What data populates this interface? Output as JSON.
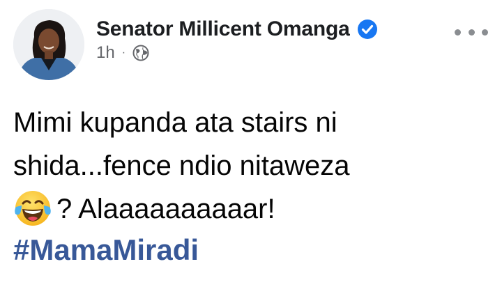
{
  "post": {
    "author": {
      "name": "Senator Millicent Omanga",
      "verified": true,
      "avatar_icon": "profile-photo"
    },
    "meta": {
      "time": "1h",
      "separator": "·",
      "audience_icon": "globe-icon"
    },
    "more_icon": "more-options-icon",
    "text": {
      "line1": "Mimi kupanda ata stairs ni",
      "line2": "shida...fence ndio nitaweza",
      "line3_emoji": "face-with-tears-of-joy-icon",
      "line3": "? Alaaaaaaaaaar!"
    },
    "hashtag": "#MamaMiradi"
  },
  "colors": {
    "link": "#385898",
    "verified_badge": "#1877f2",
    "secondary_text": "#65676b",
    "primary_text": "#050505"
  }
}
